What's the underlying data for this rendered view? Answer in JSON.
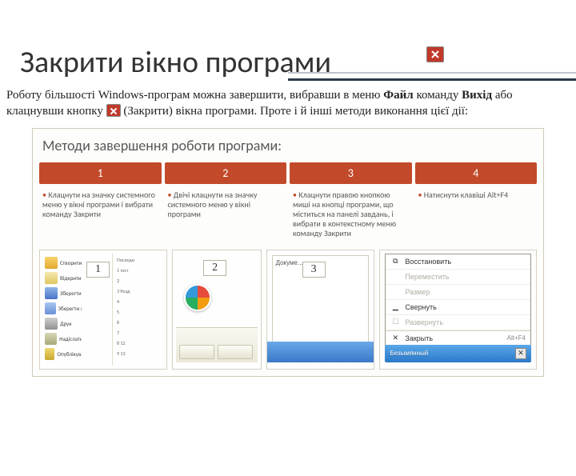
{
  "slide": {
    "title": "Закрити вікно програми",
    "body_before": "Роботу більшості Windows-програм можна завершити, вибравши в меню ",
    "bold1": "Файл",
    "body_mid1": " команду ",
    "bold2": "Вихід",
    "body_mid2": " або клацнувши кнопку ",
    "after_icon": " (Закрити) вікна програми. Проте і й інші методи виконання цієї дії:"
  },
  "figure": {
    "title": "Методи завершення роботи програми:",
    "cols": [
      {
        "n": "1",
        "text": "Клацнути на значку системного меню у вікні програми і вибрати команду Закрити"
      },
      {
        "n": "2",
        "text": "Двічі клацнути на значку системного меню у вікні програми"
      },
      {
        "n": "3",
        "text": "Клацнути правою кнопкою миші на кнопці програми, що міститься на панелі завдань, і вибрати в контекстному меню команду Закрити"
      },
      {
        "n": "4",
        "text": "Натиснути клавіші Alt+F4"
      }
    ],
    "badges": {
      "s1": "1",
      "s2": "2",
      "s3": "3"
    },
    "shot1": {
      "recent_head": "Последн",
      "items": [
        "Створити",
        "Відкрити",
        "Зберегти",
        "Зберегти як",
        "Друк",
        "Надіслати",
        "Опублікувати"
      ],
      "recent": [
        "1 тест",
        "2 ",
        "3 Розд",
        "4 ",
        "5 ",
        "6 ",
        "7 ",
        "8 12",
        "9 13"
      ]
    },
    "shot3": {
      "doc_label": "Докуме..."
    },
    "shot4": {
      "menu": [
        {
          "label": "Восстановить",
          "disabled": false,
          "icon": "restore"
        },
        {
          "label": "Переместить",
          "disabled": true,
          "icon": ""
        },
        {
          "label": "Размер",
          "disabled": true,
          "icon": ""
        },
        {
          "label": "Свернуть",
          "disabled": false,
          "icon": "min"
        },
        {
          "label": "Развернуть",
          "disabled": true,
          "icon": "max"
        }
      ],
      "close_row": {
        "label": "Закрыть",
        "shortcut": "Alt+F4",
        "icon": "x"
      },
      "taskbar_label": "Безымянный"
    }
  }
}
